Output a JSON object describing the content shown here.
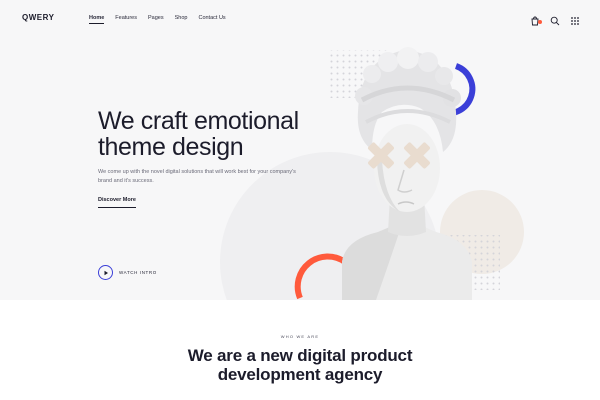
{
  "brand": {
    "logo": "QWERY"
  },
  "nav": {
    "items": [
      {
        "label": "Home",
        "active": true
      },
      {
        "label": "Features",
        "active": false
      },
      {
        "label": "Pages",
        "active": false
      },
      {
        "label": "Shop",
        "active": false
      },
      {
        "label": "Contact Us",
        "active": false
      }
    ]
  },
  "header_icons": [
    "cart-icon",
    "search-icon",
    "grid-menu-icon"
  ],
  "hero": {
    "title_line1": "We craft emotional",
    "title_line2": "theme design",
    "subtitle": "We come up with the novel digital solutions that will work best for your company's brand and it's success.",
    "cta_label": "Discover More",
    "watch_label": "WATCH INTRO"
  },
  "section": {
    "eyebrow": "WHO WE ARE",
    "title_line1": "We are a new digital product",
    "title_line2": "development agency"
  },
  "colors": {
    "accent_blue": "#3b3fd8",
    "accent_red": "#ff5a3c",
    "text_dark": "#1c1c2b",
    "hero_bg": "#f7f7f8"
  }
}
